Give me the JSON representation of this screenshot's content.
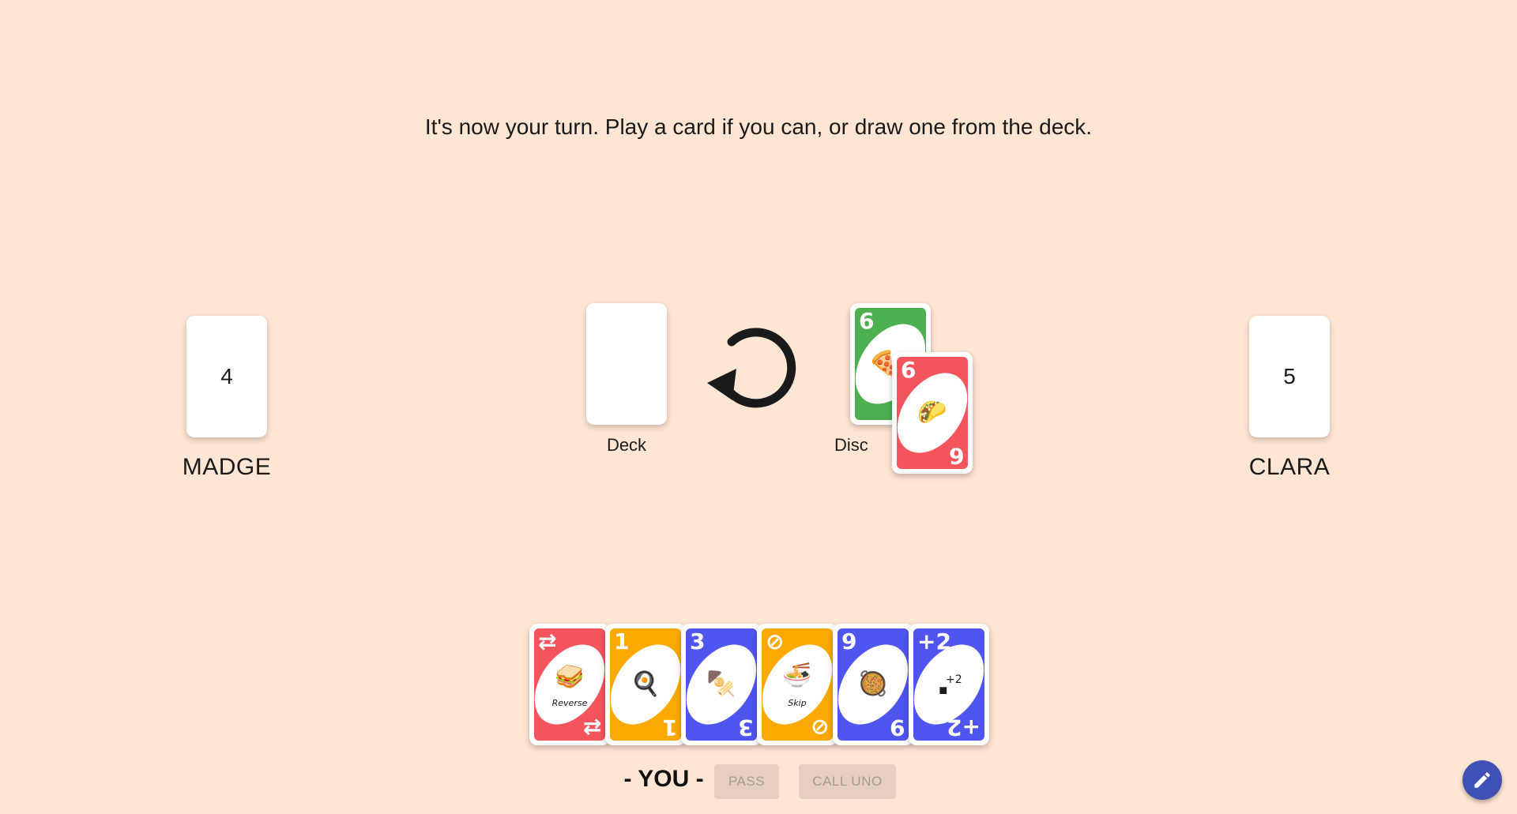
{
  "status_message": "It's now your turn. Play a card if you can, or draw one from the deck.",
  "opponents": [
    {
      "name": "MADGE",
      "card_count": "4"
    },
    {
      "name": "CLARA",
      "card_count": "5"
    }
  ],
  "deck": {
    "label": "Deck"
  },
  "discard": {
    "label": "Discard",
    "visible_label": "Disc"
  },
  "direction_icon": "rotate-counterclockwise-icon",
  "discard_cards": [
    {
      "color": "#4caf50",
      "corner": "6",
      "icon": "pizza-icon",
      "glyph": "🍕"
    },
    {
      "color": "#f4545c",
      "corner": "6",
      "icon": "taco-icon",
      "glyph": "🌮"
    }
  ],
  "hand": [
    {
      "color": "#f4545c",
      "corner": "⇄",
      "icon": "sandwich-icon",
      "glyph": "🥪",
      "caption": "Reverse"
    },
    {
      "color": "#fba800",
      "corner": "1",
      "icon": "fried-egg-icon",
      "glyph": "🍳",
      "caption": ""
    },
    {
      "color": "#5155f0",
      "corner": "3",
      "icon": "skewer-icon",
      "glyph": "🍢",
      "caption": ""
    },
    {
      "color": "#fba800",
      "corner": "⊘",
      "icon": "noodle-bowl-icon",
      "glyph": "🍜",
      "caption": "Skip"
    },
    {
      "color": "#5155f0",
      "corner": "9",
      "icon": "wok-icon",
      "glyph": "🥘",
      "caption": ""
    },
    {
      "color": "#5155f0",
      "corner": "+2",
      "icon": "draw-two-icon",
      "glyph": "■",
      "caption": "+2"
    }
  ],
  "player": {
    "label": "- YOU -"
  },
  "buttons": {
    "pass": "PASS",
    "call_uno": "CALL UNO"
  },
  "colors": {
    "background": "#ffe5d3",
    "fab": "#3f51b5"
  },
  "fab_icon": "pencil-icon"
}
